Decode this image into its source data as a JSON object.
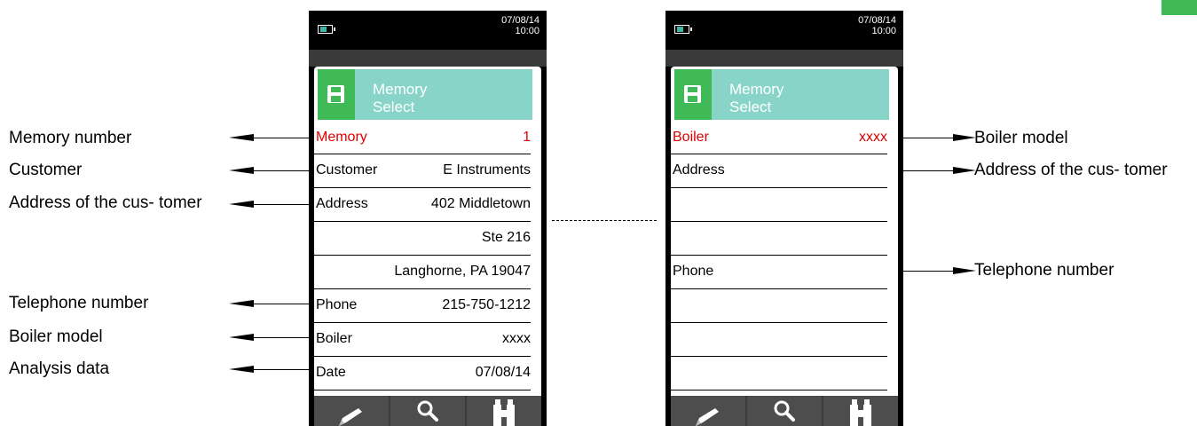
{
  "left_callouts": {
    "memory_number": "Memory number",
    "customer": "Customer",
    "address": "Address of the cus- tomer",
    "telephone": "Telephone number",
    "boiler": "Boiler model",
    "analysis": "Analysis data"
  },
  "right_callouts": {
    "boiler": "Boiler model",
    "address": "Address of the cus- tomer",
    "telephone": "Telephone number"
  },
  "device_left": {
    "status_date": "07/08/14",
    "status_time": "10:00",
    "header_line1": "Memory",
    "header_line2": "Select",
    "rows": [
      {
        "label": "Memory",
        "value": "1"
      },
      {
        "label": "Customer",
        "value": "E Instruments"
      },
      {
        "label": "Address",
        "value": "402 Middletown"
      },
      {
        "label": "",
        "value": "Ste 216"
      },
      {
        "label": "",
        "value": "Langhorne, PA 19047"
      },
      {
        "label": "Phone",
        "value": "215-750-1212"
      },
      {
        "label": "Boiler",
        "value": "xxxx"
      },
      {
        "label": "Date",
        "value": "07/08/14"
      }
    ]
  },
  "device_right": {
    "status_date": "07/08/14",
    "status_time": "10:00",
    "header_line1": "Memory",
    "header_line2": "Select",
    "rows": [
      {
        "label": "Boiler",
        "value": "xxxx"
      },
      {
        "label": "Address",
        "value": ""
      },
      {
        "label": "",
        "value": ""
      },
      {
        "label": "",
        "value": ""
      },
      {
        "label": "Phone",
        "value": ""
      },
      {
        "label": "",
        "value": ""
      },
      {
        "label": "",
        "value": ""
      },
      {
        "label": "",
        "value": ""
      }
    ]
  },
  "toolbar_icons": [
    "pencil-icon",
    "search-icon",
    "binoculars-icon"
  ],
  "colors": {
    "accent_green": "#3fba57",
    "header_teal": "#88d4c8",
    "selected_red": "#e00000"
  }
}
